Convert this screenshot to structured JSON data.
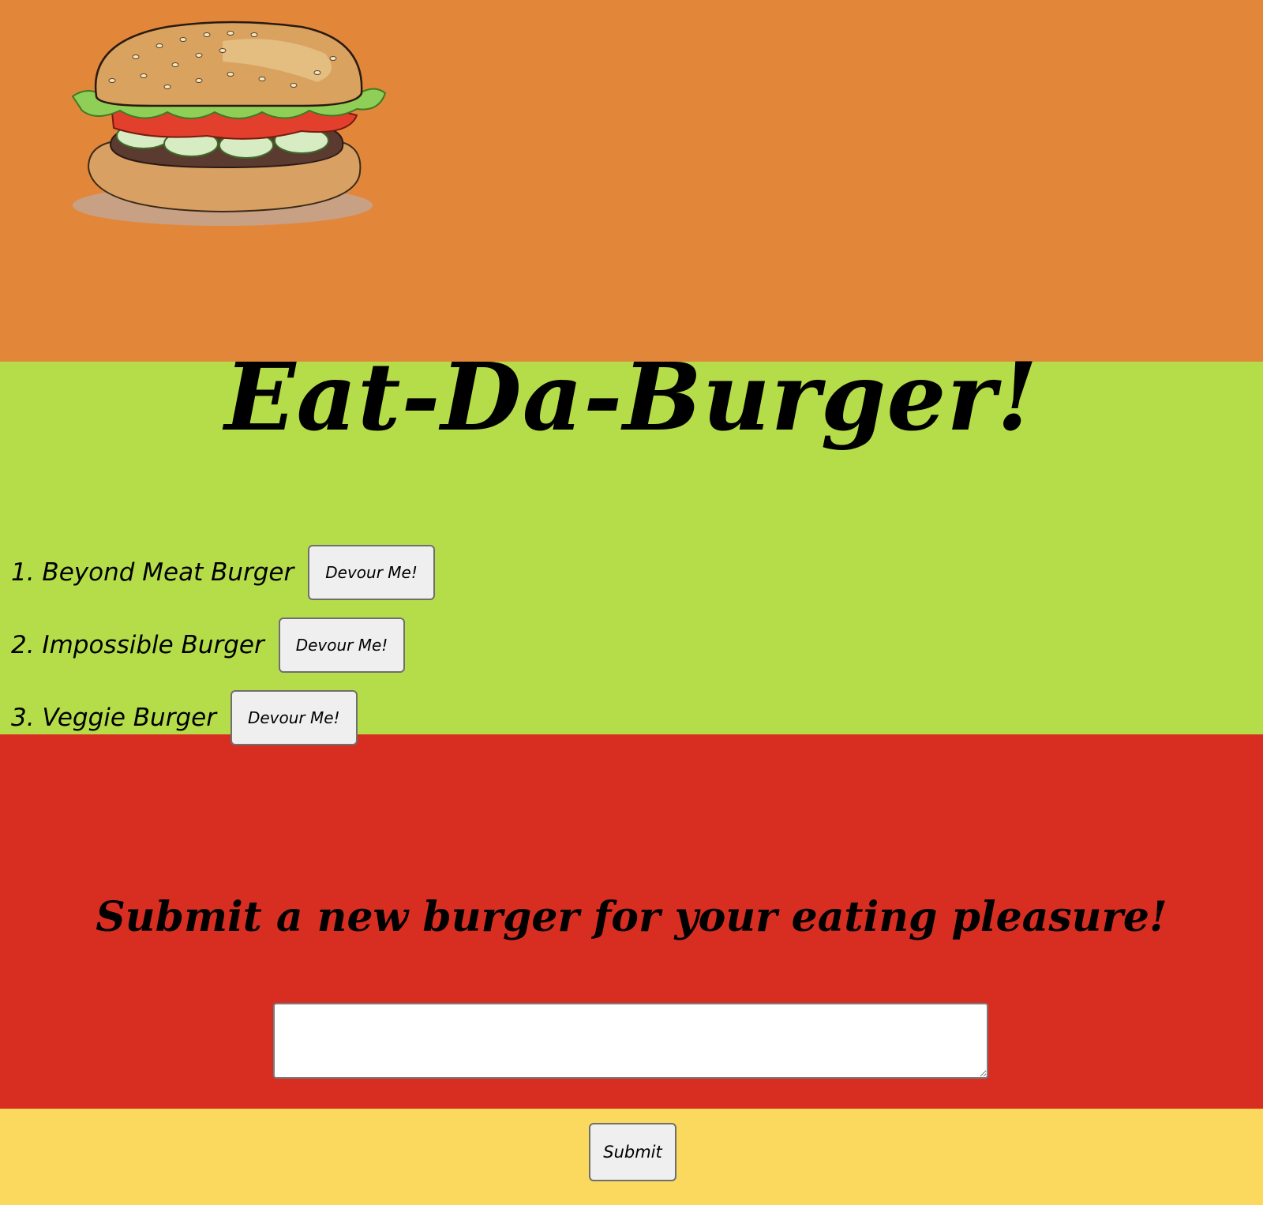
{
  "header": {
    "logo_icon": "burger-illustration-icon"
  },
  "main": {
    "title": "Eat-Da-Burger!",
    "burgers": [
      {
        "name": "1. Beyond Meat Burger",
        "button_label": "Devour Me!"
      },
      {
        "name": "2. Impossible Burger",
        "button_label": "Devour Me!"
      },
      {
        "name": "3. Veggie Burger",
        "button_label": "Devour Me!"
      }
    ]
  },
  "form": {
    "heading": "Submit a new burger for your eating pleasure!",
    "textarea_value": "",
    "submit_label": "Submit"
  },
  "colors": {
    "orange_band": "#e2873a",
    "green_band": "#b5dd4a",
    "red_band": "#d82e22",
    "yellow_band": "#fbd95e"
  }
}
